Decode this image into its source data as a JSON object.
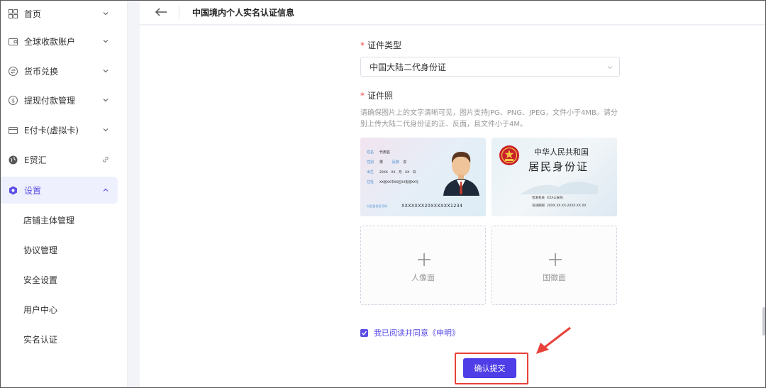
{
  "sidebar": {
    "items": [
      {
        "label": "首页",
        "icon": "grid-icon"
      },
      {
        "label": "全球收款账户",
        "icon": "wallet-icon"
      },
      {
        "label": "货币兑换",
        "icon": "exchange-icon"
      },
      {
        "label": "提现付款管理",
        "icon": "dollar-circle-icon"
      },
      {
        "label": "E付卡(虚拟卡)",
        "icon": "card-icon"
      },
      {
        "label": "E贸汇",
        "icon": "globe-icon"
      },
      {
        "label": "设置",
        "icon": "settings-gear-icon"
      }
    ],
    "sub_items": [
      "店铺主体管理",
      "协议管理",
      "安全设置",
      "用户中心",
      "实名认证"
    ]
  },
  "header": {
    "title": "中国境内个人实名认证信息"
  },
  "form": {
    "id_type_label": "证件类型",
    "id_type_value": "中国大陆二代身份证",
    "id_photo_label": "证件照",
    "hint": "请确保图片上的文字清晰可见，图片支持JPG、PNG、JPEG，文件小于4MB。请分别上传大陆二代身份证的正、反面，且文件小于4M。",
    "sample_front": {
      "name_key": "姓名",
      "name_val": "代用名",
      "gender_key": "性别",
      "gender_val": "男",
      "ethnic_key": "民族",
      "ethnic_val": "汉",
      "birth_key": "出生",
      "birth_val": "20XX　XX　月　XX　日",
      "addr_key": "住址",
      "addr_val": "XX省XX市XX区XX街道XX号",
      "id_key": "公民身份证号码",
      "id_val": "XXXXXXX20XXXXXX1234"
    },
    "sample_back": {
      "country": "中华人民共和国",
      "card_title": "居民身份证",
      "issuer_key": "签发机关",
      "issuer_val": "XXX公安局",
      "valid_key": "有效期限",
      "valid_val": "20XX.XX.XX-20XX.XX.XX"
    },
    "upload_front_label": "人像面",
    "upload_back_label": "国徽面",
    "agree_text": "我已阅读并同意《申明》",
    "submit_label": "确认提交"
  },
  "colors": {
    "accent": "#4f3ee8",
    "highlight": "#e8413a",
    "required": "#f04848"
  }
}
